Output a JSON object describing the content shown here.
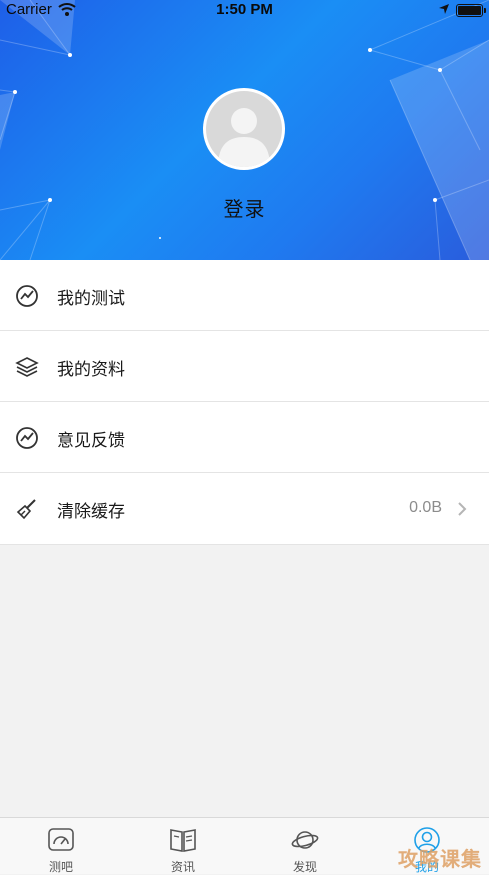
{
  "status_bar": {
    "carrier": "Carrier",
    "time": "1:50 PM",
    "battery_level": 1.0
  },
  "profile": {
    "login_label": "登录"
  },
  "menu": {
    "items": [
      {
        "label": "我的测试",
        "icon": "trend-chart-icon"
      },
      {
        "label": "我的资料",
        "icon": "layers-icon"
      },
      {
        "label": "意见反馈",
        "icon": "trend-chart-icon"
      },
      {
        "label": "清除缓存",
        "icon": "broom-icon",
        "value": "0.0B"
      }
    ]
  },
  "tabbar": {
    "tabs": [
      {
        "label": "测吧",
        "icon": "gauge-icon",
        "active": false
      },
      {
        "label": "资讯",
        "icon": "book-icon",
        "active": false
      },
      {
        "label": "发现",
        "icon": "planet-icon",
        "active": false
      },
      {
        "label": "我的",
        "icon": "user-icon",
        "active": true
      }
    ],
    "active_color": "#1fa0e8"
  },
  "watermark": "攻略课集",
  "colors": {
    "header_gradient_start": "#1e5fe8",
    "header_gradient_mid": "#1a8ef5"
  }
}
